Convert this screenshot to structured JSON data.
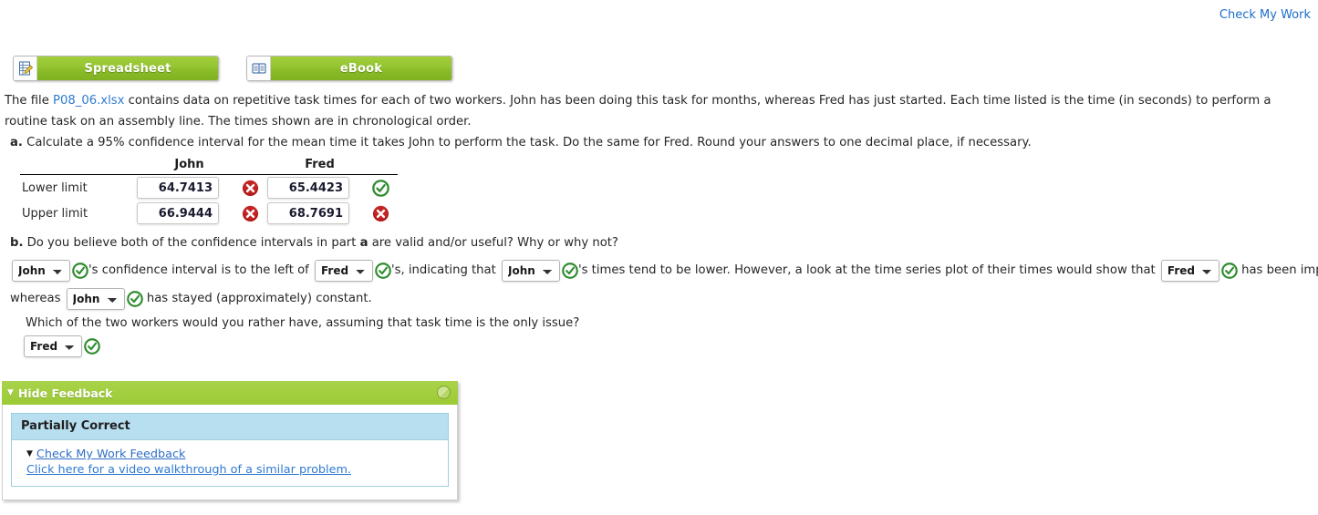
{
  "top": {
    "check_my_work_label": "Check My Work"
  },
  "resources": {
    "buttons": [
      {
        "label": "Spreadsheet",
        "icon": "spreadsheet-icon"
      },
      {
        "label": "eBook",
        "icon": "ebook-icon"
      }
    ]
  },
  "problem": {
    "intro_pre": "The file ",
    "intro_link": "P08_06.xlsx",
    "intro_post": " contains data on repetitive task times for each of two workers. John has been doing this task for months, whereas Fred has just started. Each time listed is the time (in seconds) to perform a routine task on an assembly line. The times shown are in chronological order.",
    "part_a_letter": "a.",
    "part_a_text": " Calculate a 95% confidence interval for the mean time it takes John to perform the task. Do the same for Fred. Round your answers to one decimal place, if necessary.",
    "part_b_letter": "b.",
    "part_b_text_1": " Do you believe both of the confidence intervals in part ",
    "part_b_bold": "a",
    "part_b_text_2": " are valid and/or useful? Why or why not?"
  },
  "answer_table": {
    "columns": [
      "John",
      "Fred"
    ],
    "rows": [
      {
        "label": "Lower limit",
        "cells": [
          {
            "value": "64.7413",
            "status": "incorrect"
          },
          {
            "value": "65.4423",
            "status": "correct"
          }
        ]
      },
      {
        "label": "Upper limit",
        "cells": [
          {
            "value": "66.9444",
            "status": "incorrect"
          },
          {
            "value": "68.7691",
            "status": "incorrect"
          }
        ]
      }
    ]
  },
  "part_b": {
    "line1": {
      "dd1_value": "John",
      "text1": "'s confidence interval is to the left of ",
      "dd2_value": "Fred",
      "text2": "'s, indicating that ",
      "dd3_value": "John",
      "text3": "'s times tend to be lower. However, a look at the time series plot of their times would show that ",
      "dd4_value": "Fred",
      "text4": " has been improving,",
      "dd1_status": "correct",
      "dd2_status": "correct",
      "dd3_status": "correct",
      "dd4_status": "correct"
    },
    "line2": {
      "text_pre": "whereas ",
      "dd_value": "John",
      "dd_status": "correct",
      "text_post": " has stayed (approximately) constant."
    },
    "line3": {
      "text": "Which of the two workers would you rather have, assuming that task time is the only issue?"
    },
    "line4": {
      "dd_value": "Fred",
      "dd_status": "correct"
    },
    "dropdown_options": [
      "John",
      "Fred"
    ]
  },
  "feedback": {
    "header_label": "Hide Feedback",
    "title": "Partially Correct",
    "link_label": "Check My Work Feedback",
    "sub_label": "Click here for a video walkthrough of a similar problem."
  },
  "colors": {
    "accent_green": "#9ccb36",
    "link_blue": "#2f7ad1",
    "correct_green": "#2f8c2f",
    "incorrect_red": "#b11717",
    "feedback_blue": "#b8dff0"
  }
}
